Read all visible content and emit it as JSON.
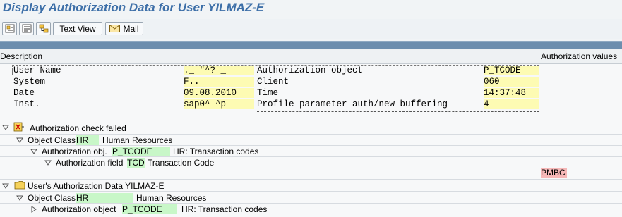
{
  "window": {
    "title": "Display Authorization Data for User YILMAZ-E"
  },
  "toolbar": {
    "buttons": [
      {
        "icon": "expand-all-icon"
      },
      {
        "icon": "collapse-all-icon"
      },
      {
        "icon": "hierarchy-icon"
      }
    ],
    "text_view_label": "Text View",
    "mail_label": "Mail"
  },
  "columns": {
    "description": "Description",
    "auth_values": "Authorization values"
  },
  "header_block": {
    "user_name_label": "User Name",
    "user_name_value": "._-\"^? _",
    "auth_object_label": "Authorization object",
    "auth_object_value": "P_TCODE",
    "system_label": "System",
    "system_value": "F..",
    "client_label": "Client",
    "client_value": "060",
    "date_label": "Date",
    "date_value": "09.08.2010",
    "time_label": "Time",
    "time_value": "14:37:48",
    "inst_label": "Inst.",
    "inst_value": "sap0^ ^p",
    "profile_param_label": "Profile parameter auth/new buffering",
    "profile_param_value": "4"
  },
  "tree": {
    "check_failed": "Authorization check failed",
    "object_class_label": "Object Class",
    "object_class_code": "HR",
    "object_class_text": "Human Resources",
    "auth_obj_label": "Authorization obj.",
    "auth_obj_code": "P_TCODE",
    "auth_obj_text": "HR: Transaction codes",
    "auth_field_label": "Authorization field",
    "auth_field_code": "TCD",
    "auth_field_text": "Transaction Code",
    "failed_value": "PMBC",
    "user_auth_data": "User's Authorization Data YILMAZ-E",
    "object_class2_label": "Object Class",
    "object_class2_code": "HR",
    "object_class2_text": "Human Resources",
    "auth_object2_label": "Authorization object",
    "auth_object2_code": "P_TCODE",
    "auth_object2_text": "HR: Transaction codes"
  },
  "colors": {
    "title": "#3d6fa8",
    "value_bg": "#fdfbb3",
    "code_bg": "#c8f7c8",
    "failed_bg": "#f6b7b7"
  }
}
